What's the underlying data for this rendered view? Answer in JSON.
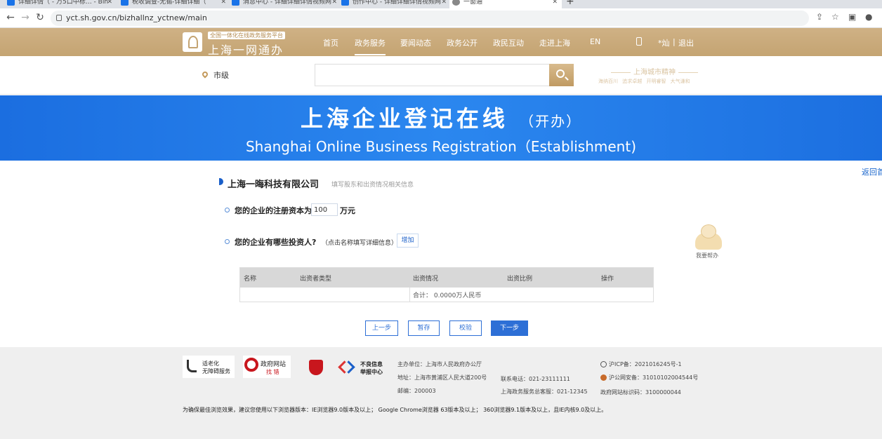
{
  "browser": {
    "tabs": [
      {
        "title": "详细详情（ - 万5口中标… - Bin"
      },
      {
        "title": "税收调查-无锡-详细详细（"
      },
      {
        "title": "消息中心 - 详细详细详情视频网"
      },
      {
        "title": "创作中心 - 详细详细详情视频网"
      },
      {
        "title": "一窗通"
      }
    ],
    "url": "yct.sh.gov.cn/bizhallnz_yctnew/main"
  },
  "gov_header": {
    "tagline": "全国一体化在线政务服务平台",
    "brand": "上海一网通办",
    "nav": [
      "首页",
      "政务服务",
      "要闻动态",
      "政务公开",
      "政民互动",
      "走进上海",
      "EN"
    ],
    "user": "*灿",
    "logout": "退出",
    "divider": "|"
  },
  "search": {
    "city": "市级",
    "placeholder": "",
    "slogan_title": "上海城市精神",
    "slogan_words": "海纳百川  追求卓越  开明睿智  大气谦和"
  },
  "banner": {
    "title_cn": "上海企业登记在线",
    "title_cn_sub": "（开办）",
    "title_en": "Shanghai Online Business Registration（Establishment)"
  },
  "main": {
    "back_link": "返回首",
    "company_name": "上海一晦科技有限公司",
    "company_hint": "填写股东和出资情况相关信息",
    "q1_label": "您的企业的注册资本为",
    "q1_value": "100",
    "q1_unit": "万元",
    "q2_label": "您的企业有哪些投资人?",
    "q2_hint": "（点击名称填写详细信息）",
    "add_button": "增加",
    "assistant_label": "我要帮办",
    "table": {
      "columns": [
        "名称",
        "出资者类型",
        "出资情况",
        "出资比例",
        "操作"
      ],
      "total": "合计： 0.0000万人民币"
    },
    "buttons": {
      "prev": "上一步",
      "save": "暂存",
      "validate": "校验",
      "next": "下一步"
    }
  },
  "footer": {
    "elderly_line1": "适老化",
    "elderly_line2": "无障碍服务",
    "gov_site_line1": "政府网站",
    "gov_site_line2": "找 错",
    "report_line1": "不良信息",
    "report_line2": "举报中心",
    "sponsor": "主办单位：上海市人民政府办公厅",
    "address": "地址：上海市黄浦区人民大道200号",
    "postcode": "邮编：200003",
    "phone": "联系电话：021-23111111",
    "hotline": "上海政务服务总客服：021-12345",
    "icp": "沪ICP备：2021016245号-1",
    "police": "沪公网安备：31010102004544号",
    "site_code": "政府网站标识码：3100000044",
    "browser_note": "为确保最佳浏览效果，建议您使用以下浏览器版本：IE浏览器9.0版本及以上； Google Chrome浏览器 63版本及以上； 360浏览器9.1版本及以上，且IE内核9.0及以上。"
  }
}
